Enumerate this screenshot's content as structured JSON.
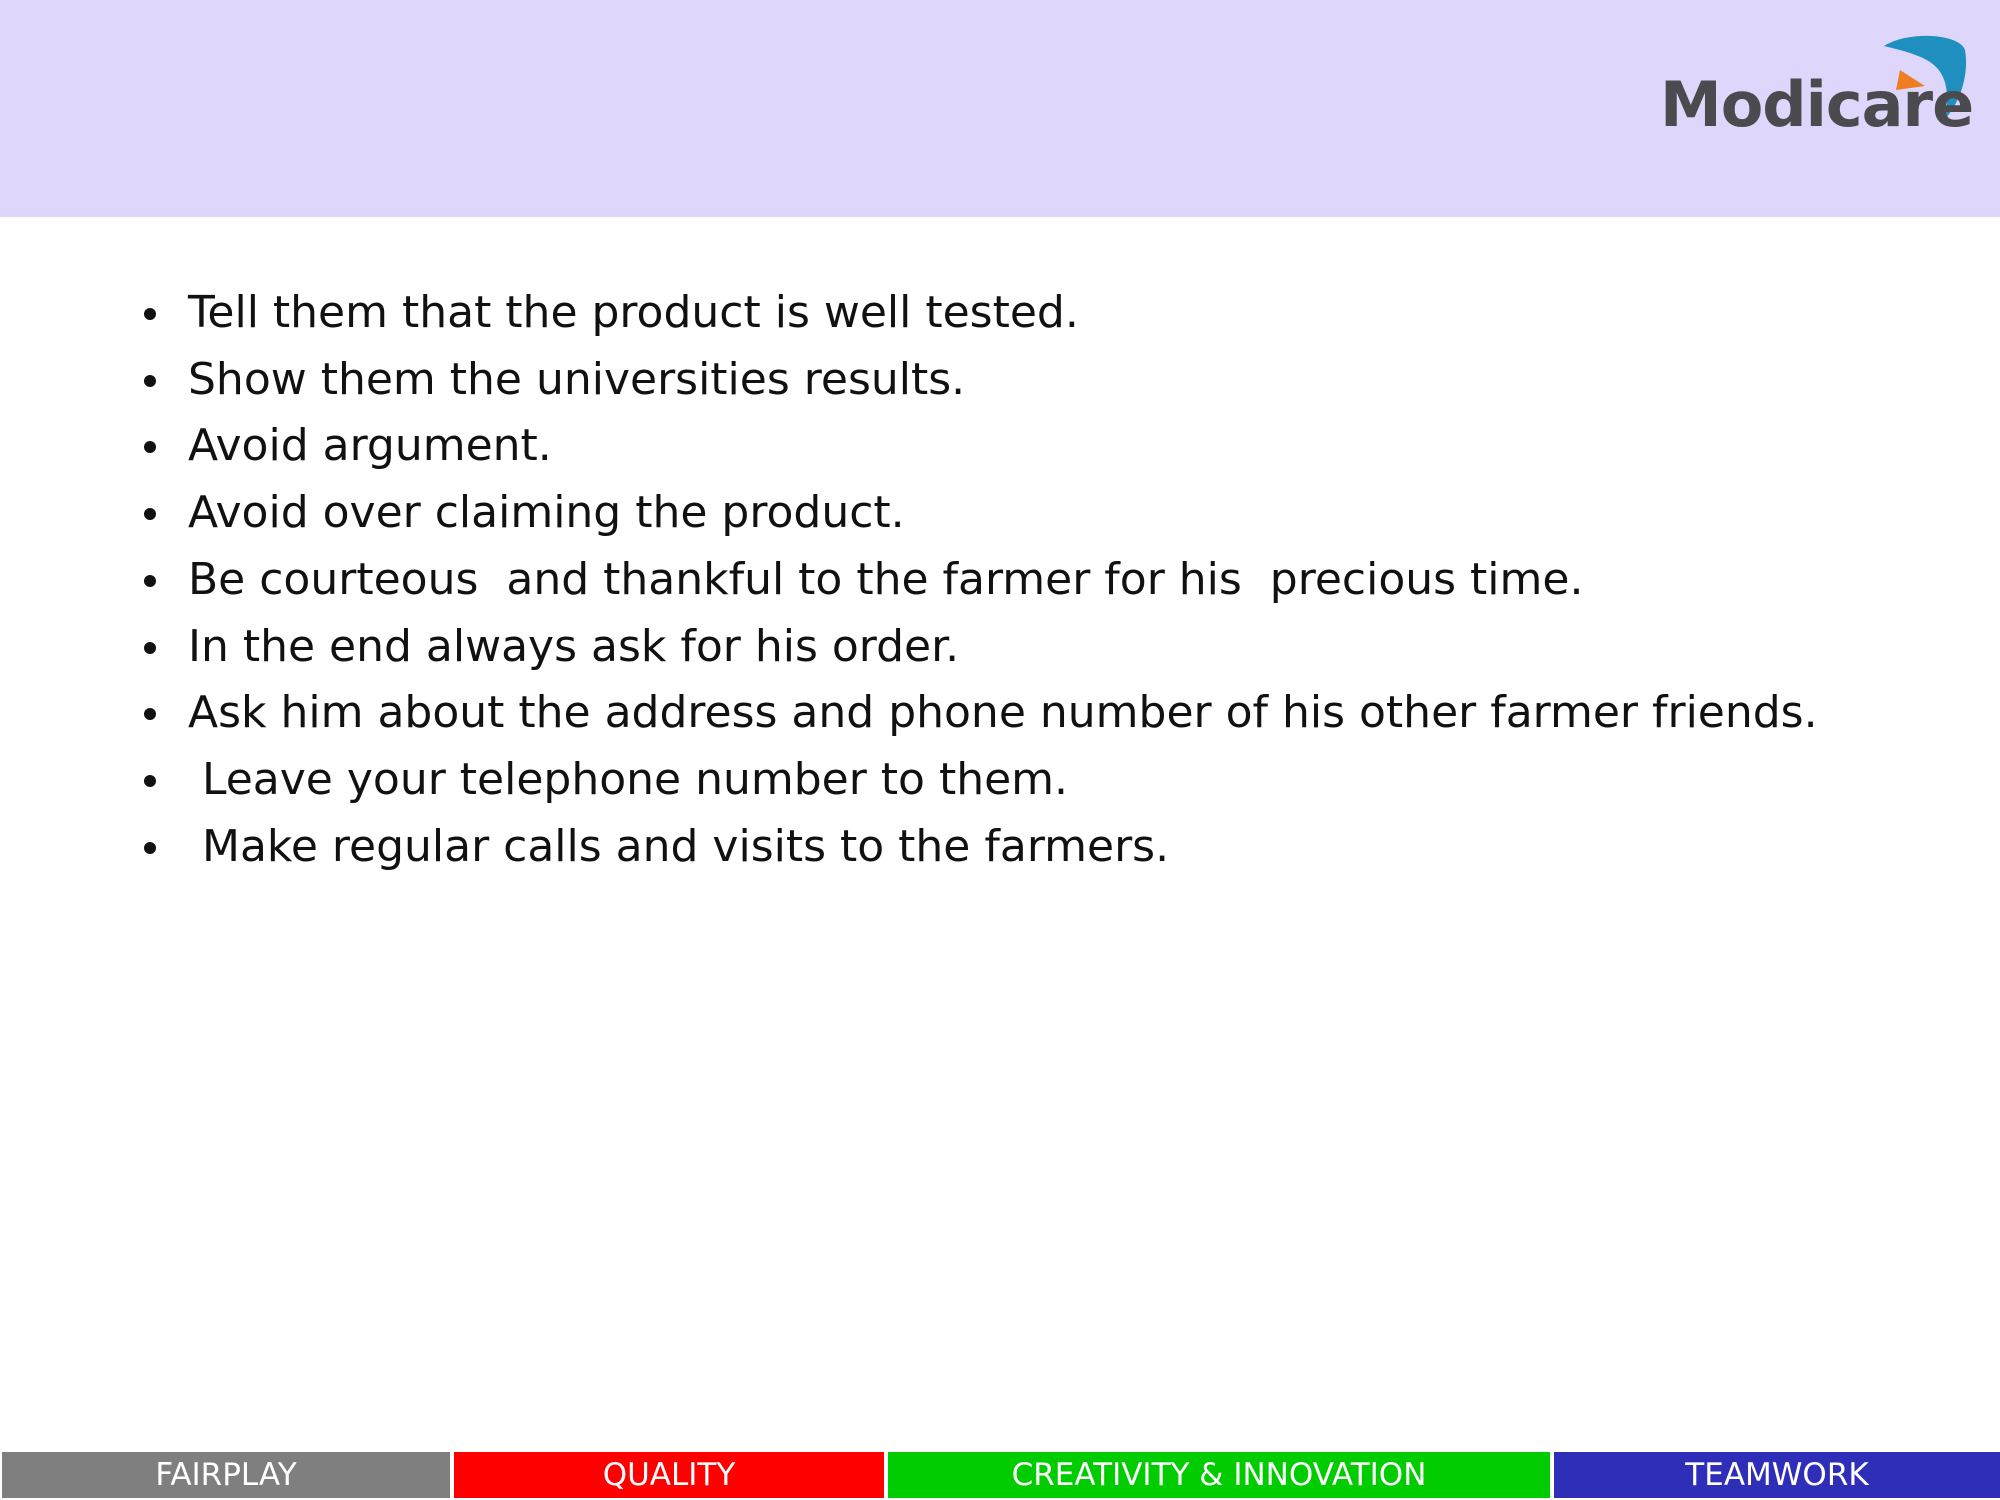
{
  "header": {
    "background": "#ded7fb",
    "logo": {
      "text": "Modicare",
      "mark_colors": {
        "blue": "#1f8fc0",
        "orange": "#ef7d22"
      }
    }
  },
  "bullets": [
    "Tell them that the product is well tested.",
    "Show them the universities results.",
    "Avoid argument.",
    "Avoid over claiming the product.",
    "Be courteous  and thankful to the farmer for his  precious time.",
    "In the end always ask for his order.",
    "Ask him about the address and phone number of his other farmer friends.",
    " Leave your telephone number to them.",
    " Make regular calls and visits to the farmers."
  ],
  "footer": {
    "values": [
      {
        "label": "FAIRPLAY",
        "color": "#7f7f7f"
      },
      {
        "label": "QUALITY",
        "color": "#ff0000"
      },
      {
        "label": "CREATIVITY & INNOVATION",
        "color": "#00cc00"
      },
      {
        "label": "TEAMWORK",
        "color": "#2e2eb8"
      }
    ]
  }
}
